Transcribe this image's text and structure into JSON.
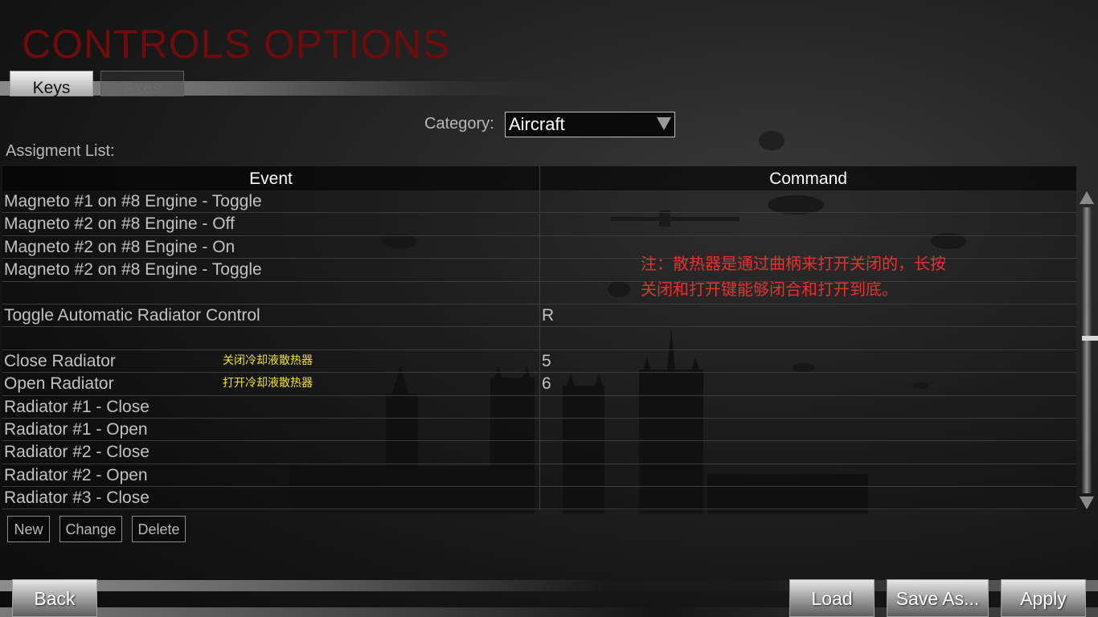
{
  "title": "CONTROLS OPTIONS",
  "tabs": [
    {
      "label": "Keys",
      "active": true
    },
    {
      "label": "Axes",
      "active": false
    }
  ],
  "category": {
    "label": "Category:",
    "value": "Aircraft"
  },
  "assignment_list_label": "Assigment List:",
  "table": {
    "headers": {
      "event": "Event",
      "command": "Command"
    },
    "rows": [
      {
        "event": "Magneto #1 on #8 Engine - Toggle",
        "command": "",
        "note": ""
      },
      {
        "event": "Magneto #2 on #8 Engine - Off",
        "command": "",
        "note": ""
      },
      {
        "event": "Magneto #2 on #8 Engine - On",
        "command": "",
        "note": ""
      },
      {
        "event": "Magneto #2 on #8 Engine - Toggle",
        "command": "",
        "note": ""
      },
      {
        "event": "",
        "command": "",
        "note": ""
      },
      {
        "event": "Toggle Automatic Radiator Control",
        "command": "R",
        "note": ""
      },
      {
        "event": "",
        "command": "",
        "note": ""
      },
      {
        "event": "Close Radiator",
        "command": "5",
        "note": "关闭冷却液散热器"
      },
      {
        "event": "Open Radiator",
        "command": "6",
        "note": "打开冷却液散热器"
      },
      {
        "event": "Radiator #1 - Close",
        "command": "",
        "note": ""
      },
      {
        "event": "Radiator #1 - Open",
        "command": "",
        "note": ""
      },
      {
        "event": "Radiator #2 - Close",
        "command": "",
        "note": ""
      },
      {
        "event": "Radiator #2 - Open",
        "command": "",
        "note": ""
      },
      {
        "event": "Radiator #3 - Close",
        "command": "",
        "note": ""
      }
    ]
  },
  "annotation": "注：散热器是通过曲柄来打开关闭的，长按关闭和打开键能够闭合和打开到底。",
  "list_buttons": {
    "new": "New",
    "change": "Change",
    "delete": "Delete"
  },
  "footer_buttons": {
    "back": "Back",
    "load": "Load",
    "save_as": "Save As...",
    "apply": "Apply"
  },
  "colors": {
    "title": "#6e0c0c",
    "annotation": "#e8302e",
    "row_note": "#f2e51a"
  }
}
